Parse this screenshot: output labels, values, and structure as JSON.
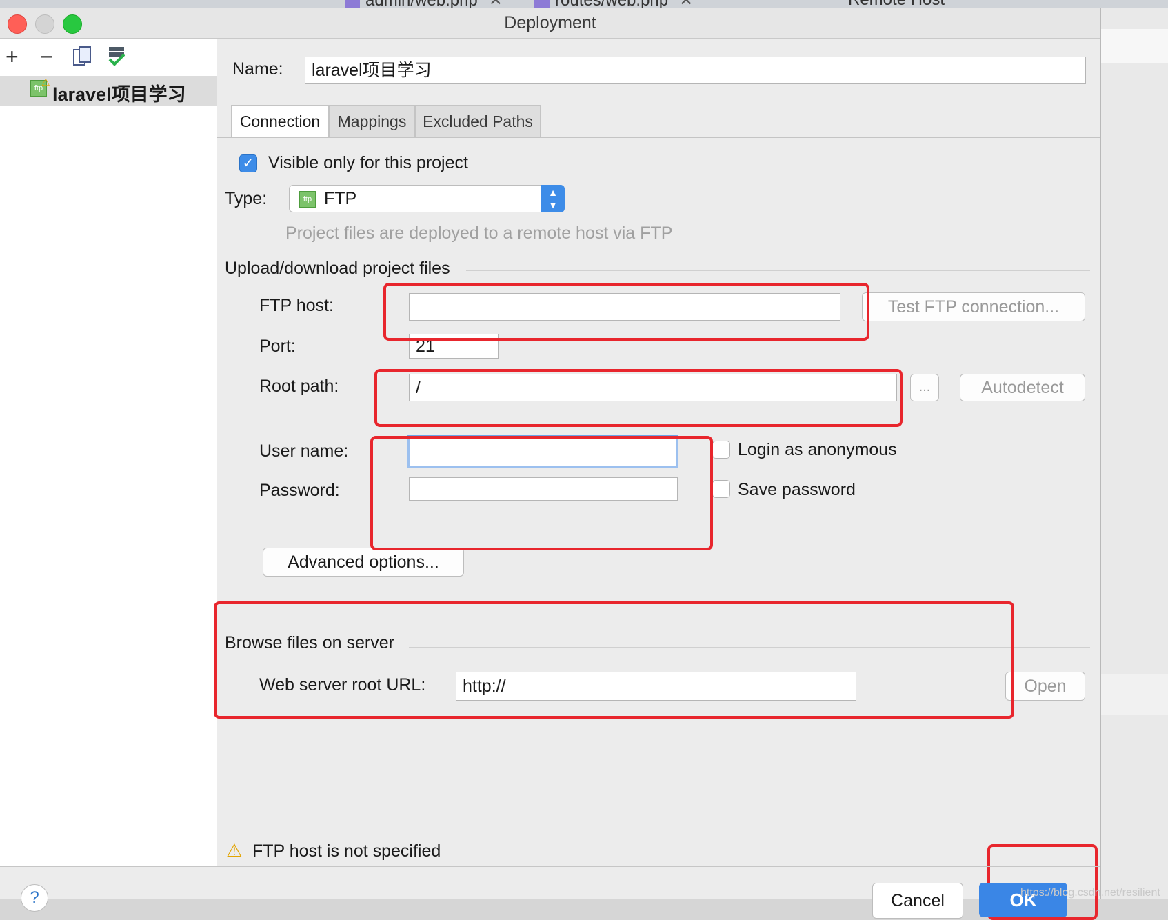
{
  "background_tabs": [
    {
      "label": "admin/web.php"
    },
    {
      "label": "routes/web.php"
    },
    {
      "label": "Remote Host"
    }
  ],
  "window": {
    "title": "Deployment"
  },
  "sidebar": {
    "toolbar": {
      "add": "+",
      "remove": "−"
    },
    "servers": [
      {
        "name": "laravel项目学习",
        "type_badge": "ftp"
      }
    ]
  },
  "form": {
    "name_label": "Name:",
    "name_value": "laravel项目学习",
    "tabs": [
      {
        "label": "Connection",
        "active": true
      },
      {
        "label": "Mappings",
        "active": false
      },
      {
        "label": "Excluded Paths",
        "active": false
      }
    ],
    "visible_only": {
      "label": "Visible only for this project",
      "checked": true
    },
    "type_label": "Type:",
    "type_value": "FTP",
    "type_hint": "Project files are deployed to a remote host via FTP",
    "upload_section": "Upload/download project files",
    "ftp_host_label": "FTP host:",
    "ftp_host_value": "",
    "test_button": "Test FTP connection...",
    "port_label": "Port:",
    "port_value": "21",
    "root_path_label": "Root path:",
    "root_path_value": "/",
    "browse_button": "...",
    "autodetect_button": "Autodetect",
    "user_label": "User name:",
    "user_value": "",
    "login_anonymous": {
      "label": "Login as anonymous",
      "checked": false
    },
    "password_label": "Password:",
    "password_value": "",
    "save_password": {
      "label": "Save password",
      "checked": false
    },
    "advanced_button": "Advanced options...",
    "browse_section": "Browse files on server",
    "web_root_label": "Web server root URL:",
    "web_root_value": "http://",
    "open_button": "Open",
    "warning_text": "FTP host is not specified"
  },
  "footer": {
    "help": "?",
    "cancel": "Cancel",
    "ok": "OK"
  },
  "watermark": "https://blog.csdn.net/resilient",
  "colors": {
    "accent": "#3d8ce8",
    "annotation_red": "#e8262d",
    "warning": "#e2a400"
  }
}
